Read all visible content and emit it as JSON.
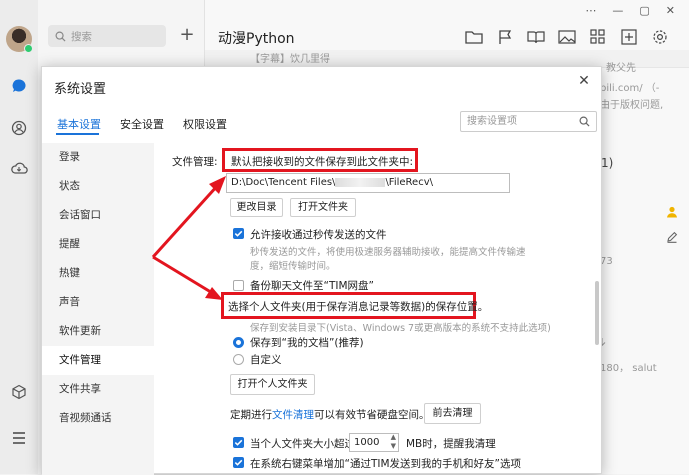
{
  "app": {
    "search_placeholder": "搜索",
    "add_symbol": "+",
    "chat_title": "动漫Python",
    "window_controls": [
      "⋯",
      "—",
      "▢",
      "✕"
    ],
    "chat_strip_text": "【字幕】饮几里得"
  },
  "right_fragments": {
    "name_fragment": "教父先",
    "url_fragment": "bili.com/  （-",
    "desc_fragment": "由于版权问题,",
    "number_fragment": "1)",
    "num_73": "73",
    "salut": "180， salut"
  },
  "dialog": {
    "title": "系统设置",
    "close": "✕",
    "tabs": [
      "基本设置",
      "安全设置",
      "权限设置"
    ],
    "search_placeholder": "搜索设置项",
    "sidebar": [
      "登录",
      "状态",
      "会话窗口",
      "提醒",
      "热键",
      "声音",
      "软件更新",
      "文件管理",
      "文件共享",
      "音视频通话"
    ],
    "sidebar_active_index": 7,
    "file_mgmt": {
      "label": "文件管理:",
      "default_save_text": "默认把接收到的文件保存到此文件夹中:",
      "path_prefix": "D:\\Doc\\Tencent Files\\",
      "path_suffix": "\\FileRecv\\",
      "change_dir_button": "更改目录",
      "open_folder_button": "打开文件夹",
      "allow_transfer_label": "允许接收通过秒传发送的文件",
      "allow_transfer_desc_1": "秒传发送的文件，将使用极速服务器辅助接收，能提高文件传输速",
      "allow_transfer_desc_2": "度，缩短传输时间。",
      "backup_label": "备份聊天文件至“TIM网盘”",
      "personal_folder_text": "选择个人文件夹(用于保存消息记录等数据)的保存位置。",
      "personal_folder_hint": "保存到安装目录下(Vista、Windows 7或更高版本的系统不支持此选项)",
      "radio_my_docs": "保存到“我的文档”(推荐)",
      "radio_custom": "自定义",
      "open_personal_button": "打开个人文件夹",
      "cleanup_prefix": "定期进行",
      "cleanup_link": "文件清理",
      "cleanup_suffix": "可以有效节省硬盘空间。",
      "cleanup_button": "前去清理",
      "size_prefix": "当个人文件夹大小超过",
      "size_value": "1000",
      "size_suffix": "MB时，提醒我清理",
      "context_menu_label": "在系统右键菜单增加“通过TIM发送到我的手机和好友”选项"
    }
  },
  "colors": {
    "accent": "#1a73d9",
    "annotation_red": "#e3151f"
  }
}
